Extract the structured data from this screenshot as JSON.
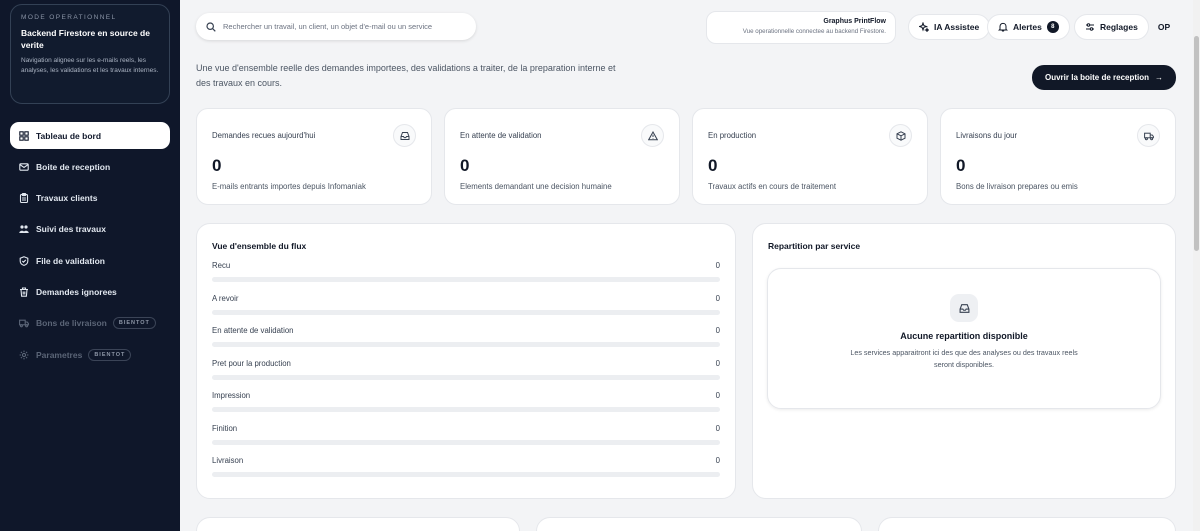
{
  "sidebar": {
    "mode": {
      "eyebrow": "MODE OPERATIONNEL",
      "title": "Backend Firestore en source de verite",
      "description": "Navigation alignee sur les e-mails reels, les analyses, les validations et les travaux internes."
    },
    "items": [
      {
        "label": "Tableau de bord",
        "icon": "dashboard-icon",
        "active": true
      },
      {
        "label": "Boite de reception",
        "icon": "mail-icon"
      },
      {
        "label": "Travaux clients",
        "icon": "clipboard-icon"
      },
      {
        "label": "Suivi des travaux",
        "icon": "users-icon"
      },
      {
        "label": "File de validation",
        "icon": "shield-icon"
      },
      {
        "label": "Demandes ignorees",
        "icon": "trash-icon"
      },
      {
        "label": "Bons de livraison",
        "icon": "truck-icon",
        "disabled": true,
        "badge": "BIENTOT"
      },
      {
        "label": "Parametres",
        "icon": "gear-icon",
        "disabled": true,
        "badge": "BIENTOT"
      }
    ]
  },
  "topbar": {
    "search_placeholder": "Rechercher un travail, un client, un objet d'e-mail ou un service",
    "brand_name": "Graphus PrintFlow",
    "brand_sub": "Vue operationnelle connectee au backend Firestore.",
    "ai_label": "IA Assistee",
    "alerts_label": "Alertes",
    "alerts_count": "8",
    "settings_label": "Reglages",
    "avatar": "OP"
  },
  "intro": "Une vue d'ensemble reelle des demandes importees, des validations a traiter, de la preparation interne et des travaux en cours.",
  "cta": {
    "label": "Ouvrir la boite de reception",
    "arrow": "→"
  },
  "stats": [
    {
      "label": "Demandes recues aujourd'hui",
      "value": "0",
      "desc": "E-mails entrants importes depuis Infomaniak",
      "icon": "inbox-icon"
    },
    {
      "label": "En attente de validation",
      "value": "0",
      "desc": "Elements demandant une decision humaine",
      "icon": "warning-icon"
    },
    {
      "label": "En production",
      "value": "0",
      "desc": "Travaux actifs en cours de traitement",
      "icon": "box-icon"
    },
    {
      "label": "Livraisons du jour",
      "value": "0",
      "desc": "Bons de livraison prepares ou emis",
      "icon": "truck-icon"
    }
  ],
  "flow": {
    "title": "Vue d'ensemble du flux",
    "rows": [
      {
        "label": "Recu",
        "value": "0",
        "fill": 0
      },
      {
        "label": "A revoir",
        "value": "0",
        "fill": 0
      },
      {
        "label": "En attente de validation",
        "value": "0",
        "fill": 0
      },
      {
        "label": "Pret pour la production",
        "value": "0",
        "fill": 0
      },
      {
        "label": "Impression",
        "value": "0",
        "fill": 0
      },
      {
        "label": "Finition",
        "value": "0",
        "fill": 0
      },
      {
        "label": "Livraison",
        "value": "0",
        "fill": 0
      }
    ]
  },
  "service": {
    "title": "Repartition par service",
    "empty_title": "Aucune repartition disponible",
    "empty_desc": "Les services apparaitront ici des que des analyses ou des travaux reels seront disponibles."
  }
}
